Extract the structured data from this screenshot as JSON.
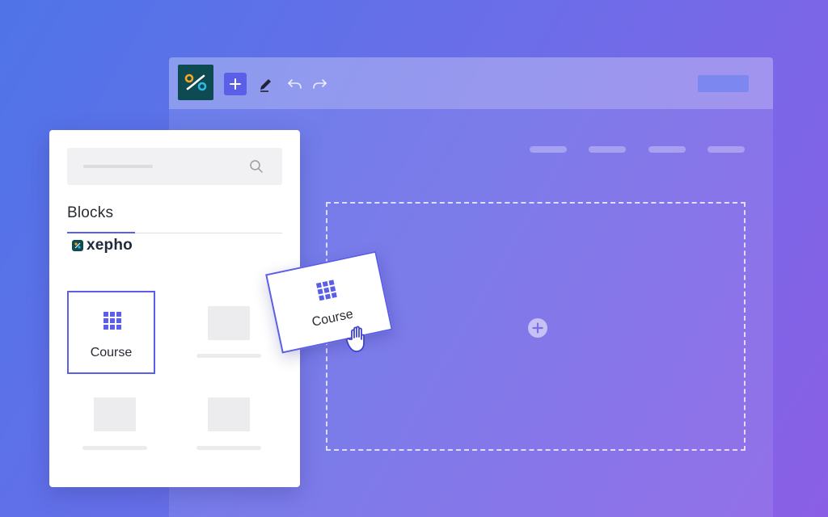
{
  "colors": {
    "accent": "#5b5ee6",
    "logo_bg": "#0e4a52",
    "logo_orange": "#f5a623",
    "logo_blue": "#2fb8e6"
  },
  "toolbar": {
    "logo_icon": "percent-logo-icon",
    "add_icon": "plus-icon",
    "edit_icon": "pen-icon",
    "undo_icon": "undo-icon",
    "redo_icon": "redo-icon"
  },
  "canvas": {
    "drop_icon": "plus-circle-icon"
  },
  "panel": {
    "tab_label": "Blocks",
    "brand_name": "xepho",
    "blocks": [
      {
        "label": "Course",
        "icon": "grid-icon"
      }
    ]
  },
  "drag": {
    "label": "Course",
    "icon": "grid-icon",
    "cursor": "hand-grab-cursor-icon"
  }
}
